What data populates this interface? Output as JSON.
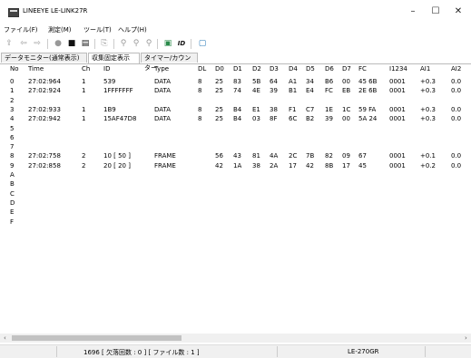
{
  "window": {
    "title": "LINEEYE LE-LINK27R",
    "minimize": "–",
    "maximize": "☐",
    "close": "✕"
  },
  "menu": [
    "ファイル(F)",
    "測定(M)",
    "ツール(T)",
    "ヘルプ(H)"
  ],
  "tabs": [
    "データモニター(通常表示)",
    "収集固定表示",
    "タイマー/カウンター"
  ],
  "active_tab": 1,
  "toolbar_icons": [
    "export-icon",
    "back-icon",
    "forward-icon",
    "record-icon",
    "stop-icon",
    "print-icon",
    "copy-icon",
    "search-icon",
    "find-next-icon",
    "find-prev-icon",
    "filter-icon",
    "id-icon",
    "panel-icon"
  ],
  "columns": [
    "No",
    "Time",
    "Ch",
    "ID",
    "Type",
    "DL",
    "D0",
    "D1",
    "D2",
    "D3",
    "D4",
    "D5",
    "D6",
    "D7",
    "FC",
    "I1234",
    "AI1",
    "AI2"
  ],
  "rows": [
    {
      "no": "0",
      "time": "27:02:964",
      "ch": "1",
      "id": "539",
      "type": "DATA",
      "dl": "8",
      "d": [
        "25",
        "83",
        "5B",
        "64",
        "A1",
        "34",
        "B6",
        "00"
      ],
      "fc": "45 6B",
      "i1234": "0001",
      "ai1": "+0.3",
      "ai2": "0.0"
    },
    {
      "no": "1",
      "time": "27:02:924",
      "ch": "1",
      "id": "1FFFFFFF",
      "type": "DATA",
      "dl": "8",
      "d": [
        "25",
        "74",
        "4E",
        "39",
        "B1",
        "E4",
        "FC",
        "EB"
      ],
      "fc": "2E 6B",
      "i1234": "0001",
      "ai1": "+0.3",
      "ai2": "0.0"
    },
    {
      "no": "2"
    },
    {
      "no": "3",
      "time": "27:02:933",
      "ch": "1",
      "id": "1B9",
      "type": "DATA",
      "dl": "8",
      "d": [
        "25",
        "B4",
        "E1",
        "38",
        "F1",
        "C7",
        "1E",
        "1C"
      ],
      "fc": "59 FA",
      "i1234": "0001",
      "ai1": "+0.3",
      "ai2": "0.0"
    },
    {
      "no": "4",
      "time": "27:02:942",
      "ch": "1",
      "id": "15AF47D8",
      "type": "DATA",
      "dl": "8",
      "d": [
        "25",
        "B4",
        "03",
        "8F",
        "6C",
        "B2",
        "39",
        "00"
      ],
      "fc": "5A 24",
      "i1234": "0001",
      "ai1": "+0.3",
      "ai2": "0.0"
    },
    {
      "no": "5"
    },
    {
      "no": "6"
    },
    {
      "no": "7"
    },
    {
      "no": "8",
      "time": "27:02:758",
      "ch": "2",
      "id": "10 [ 50 ]",
      "type": "FRAME",
      "dl": "",
      "d": [
        "56",
        "43",
        "81",
        "4A",
        "2C",
        "7B",
        "82",
        "09"
      ],
      "fc": "67",
      "i1234": "0001",
      "ai1": "+0.1",
      "ai2": "0.0"
    },
    {
      "no": "9",
      "time": "27:02:858",
      "ch": "2",
      "id": "20 [ 20 ]",
      "type": "FRAME",
      "dl": "",
      "d": [
        "42",
        "1A",
        "38",
        "2A",
        "17",
        "42",
        "8B",
        "17"
      ],
      "fc": "45",
      "i1234": "0001",
      "ai1": "+0.2",
      "ai2": "0.0"
    },
    {
      "no": "A"
    },
    {
      "no": "B"
    },
    {
      "no": "C"
    },
    {
      "no": "D"
    },
    {
      "no": "E"
    },
    {
      "no": "F"
    }
  ],
  "status": {
    "left": "1696 [ 欠落回数 : 0 ] [ ファイル数 : 1 ]",
    "device": "LE-270GR"
  },
  "scroll": {
    "left_arrow": "‹",
    "right_arrow": "›"
  }
}
